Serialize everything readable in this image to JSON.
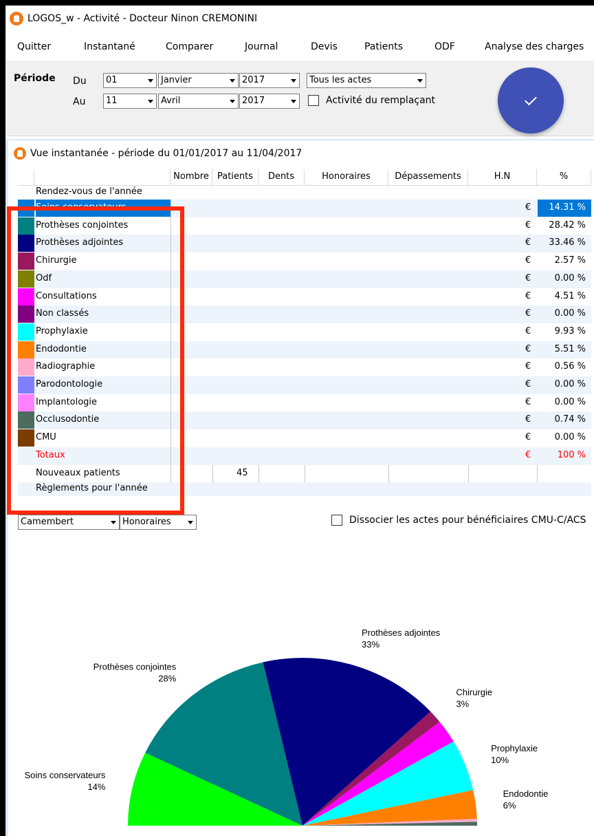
{
  "window": {
    "title": "LOGOS_w - Activité  - Docteur Ninon CREMONINI"
  },
  "menu": [
    "Quitter",
    "Instantané",
    "Comparer",
    "Journal",
    "Devis",
    "Patients",
    "ODF",
    "Analyse des charges"
  ],
  "period": {
    "label": "Période",
    "du_label": "Du",
    "au_label": "Au",
    "du": {
      "day": "01",
      "month": "Janvier",
      "year": "2017"
    },
    "au": {
      "day": "11",
      "month": "Avril",
      "year": "2017"
    },
    "acts_filter": "Tous les actes",
    "replacement_label": "Activité du remplaçant",
    "replacement_checked": false
  },
  "panel": {
    "title": "Vue instantanée - période du 01/01/2017 au 11/04/2017"
  },
  "grid": {
    "columns": [
      "Nombre",
      "Patients",
      "Dents",
      "Honoraires",
      "Dépassements",
      "H.N",
      "%"
    ],
    "top_row": "Rendez-vous de l'année",
    "rows": [
      {
        "name": "Soins conservateurs",
        "color": "#0078d7",
        "pct": "14.31 %",
        "selected": true
      },
      {
        "name": "Prothèses conjointes",
        "color": "#008080",
        "pct": "28.42 %"
      },
      {
        "name": "Prothèses adjointes",
        "color": "#000080",
        "pct": "33.46 %"
      },
      {
        "name": "Chirurgie",
        "color": "#99195e",
        "pct": "2.57 %"
      },
      {
        "name": "Odf",
        "color": "#808000",
        "pct": "0.00 %"
      },
      {
        "name": "Consultations",
        "color": "#ff00ff",
        "pct": "4.51 %"
      },
      {
        "name": "Non classés",
        "color": "#800080",
        "pct": "0.00 %"
      },
      {
        "name": "Prophylaxie",
        "color": "#00ffff",
        "pct": "9.93 %"
      },
      {
        "name": "Endodontie",
        "color": "#ff8000",
        "pct": "5.51 %"
      },
      {
        "name": "Radiographie",
        "color": "#ffaacc",
        "pct": "0.56 %"
      },
      {
        "name": "Parodontologie",
        "color": "#8080ff",
        "pct": "0.00 %"
      },
      {
        "name": "Implantologie",
        "color": "#ff80ff",
        "pct": "0.00 %"
      },
      {
        "name": "Occlusodontie",
        "color": "#4d6b5e",
        "pct": "0.74 %"
      },
      {
        "name": "CMU",
        "color": "#7a3c00",
        "pct": "0.00 %"
      }
    ],
    "totals": {
      "name": "Totaux",
      "pct": "100 %",
      "color": "#ff0000"
    },
    "new_patients": {
      "name": "Nouveaux patients",
      "patients": "45"
    },
    "bottom_row": "Règlements pour l'année",
    "euro": "€"
  },
  "chart_controls": {
    "chart_type": "Camembert",
    "measure": "Honoraires",
    "dissociate_label": "Dissocier les actes pour bénéficiaires CMU-C/ACS"
  },
  "chart_data": {
    "type": "pie",
    "slices": [
      {
        "label": "Soins conservateurs",
        "value": 14.31,
        "display": "14%",
        "color": "#00ff00"
      },
      {
        "label": "Prothèses conjointes",
        "value": 28.42,
        "display": "28%",
        "color": "#008080"
      },
      {
        "label": "Prothèses adjointes",
        "value": 33.46,
        "display": "33%",
        "color": "#000080"
      },
      {
        "label": "Chirurgie",
        "value": 2.57,
        "display": "3%",
        "color": "#99195e"
      },
      {
        "label": "Consultations",
        "value": 4.51,
        "display": "",
        "color": "#ff00ff"
      },
      {
        "label": "Prophylaxie",
        "value": 9.93,
        "display": "10%",
        "color": "#00ffff"
      },
      {
        "label": "Endodontie",
        "value": 5.51,
        "display": "6%",
        "color": "#ff8000"
      },
      {
        "label": "Radiographie",
        "value": 0.56,
        "display": "",
        "color": "#ffaacc"
      },
      {
        "label": "Occlusodontie",
        "value": 0.74,
        "display": "",
        "color": "#4d6b5e"
      }
    ]
  }
}
